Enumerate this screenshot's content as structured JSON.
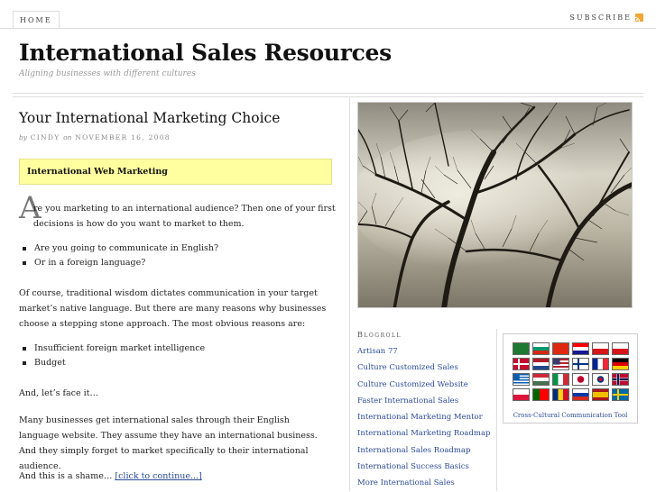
{
  "nav": {
    "home": "HOME",
    "subscribe": "SUBSCRIBE"
  },
  "header": {
    "title": "International Sales Resources",
    "tagline": "Aligning businesses with different cultures"
  },
  "post": {
    "title": "Your International Marketing Choice",
    "byline_by": "by",
    "author": "CINDY",
    "byline_on": "on",
    "date": "NOVEMBER 16, 2008",
    "highlight": "International Web Marketing",
    "dropcap": "A",
    "p1": "re you marketing to an international audience?  Then one of your first decisions is how do you want to market to them.",
    "bullets1": [
      "Are you going to communicate in English?",
      "Or in a foreign language?"
    ],
    "p2": "Of course, traditional wisdom dictates communication in your target market’s native language.  But there are many reasons why businesses choose a stepping stone approach.  The most obvious reasons are:",
    "bullets2": [
      "Insufficient foreign market intelligence",
      "Budget"
    ],
    "p3": "And, let’s face it…",
    "p4": "Many businesses get international sales through their English language website.  They assume they have an international business.  And they simply forget to market specifically to their international audience.",
    "p5": "And this is a shame…",
    "continue": "[click to continue...]"
  },
  "blogroll": {
    "heading": "Blogroll",
    "items": [
      "Artisan 77",
      "Culture Customized Sales",
      "Culture Customized Website",
      "Faster International Sales",
      "International Marketing Mentor",
      "International Marketing Roadmap",
      "International Sales Roadmap",
      "International Success Basics",
      "More International Sales"
    ]
  },
  "widget": {
    "caption": "Cross-Cultural Communication Tool",
    "flags": [
      "saudi-arabia",
      "bulgaria",
      "china",
      "croatia",
      "czech-republic",
      "czech-republic",
      "denmark",
      "netherlands",
      "united-states",
      "finland",
      "france",
      "germany",
      "greece",
      "hungary",
      "italy",
      "japan",
      "south-korea",
      "norway",
      "poland",
      "portugal",
      "romania",
      "russia",
      "spain",
      "sweden"
    ]
  }
}
